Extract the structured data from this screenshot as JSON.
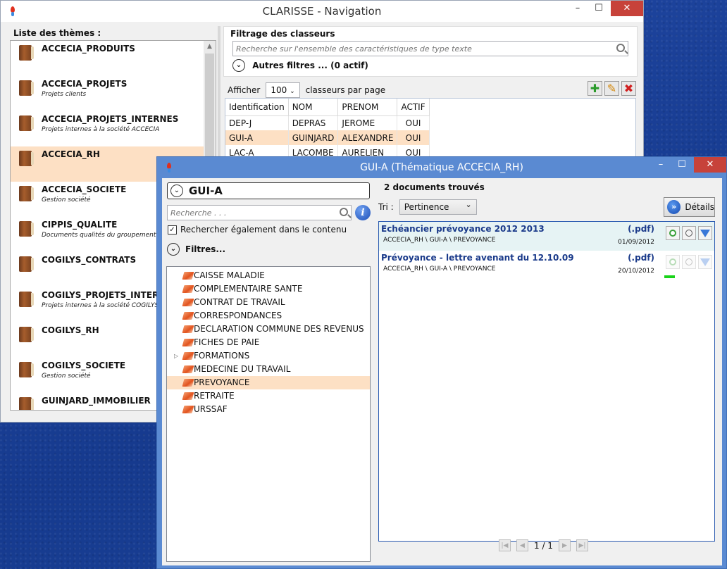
{
  "win1": {
    "title": "CLARISSE - Navigation",
    "controls": {
      "minimize": "–",
      "maximize": "☐",
      "close": "✕"
    },
    "themes_label": "Liste des thèmes :",
    "themes": [
      {
        "name": "ACCECIA_PRODUITS",
        "desc": ""
      },
      {
        "name": "ACCECIA_PROJETS",
        "desc": "Projets clients"
      },
      {
        "name": "ACCECIA_PROJETS_INTERNES",
        "desc": "Projets internes à la société ACCECIA"
      },
      {
        "name": "ACCECIA_RH",
        "desc": ""
      },
      {
        "name": "ACCECIA_SOCIETE",
        "desc": "Gestion société"
      },
      {
        "name": "CIPPIS_QUALITE",
        "desc": "Documents qualités du groupement"
      },
      {
        "name": "COGILYS_CONTRATS",
        "desc": ""
      },
      {
        "name": "COGILYS_PROJETS_INTERNES",
        "desc": "Projets internes à la société COGILYS"
      },
      {
        "name": "COGILYS_RH",
        "desc": ""
      },
      {
        "name": "COGILYS_SOCIETE",
        "desc": "Gestion société"
      },
      {
        "name": "GUINJARD_IMMOBILIER",
        "desc": ""
      }
    ],
    "selected_theme": "ACCECIA_RH",
    "filter": {
      "title": "Filtrage des classeurs",
      "search_placeholder": "Recherche sur l'ensemble des caractéristiques de type texte",
      "more_filters": "Autres filtres ... (0 actif)"
    },
    "paging": {
      "label_before": "Afficher",
      "per_page": "100",
      "label_after": "classeurs par page"
    },
    "table": {
      "columns": [
        "Identification",
        "NOM",
        "PRENOM",
        "ACTIF"
      ],
      "rows": [
        [
          "DEP-J",
          "DEPRAS",
          "JEROME",
          "OUI"
        ],
        [
          "GUI-A",
          "GUINJARD",
          "ALEXANDRE",
          "OUI"
        ],
        [
          "LAC-A",
          "LACOMBE",
          "AURELIEN",
          "OUI"
        ]
      ]
    }
  },
  "win2": {
    "title": "GUI-A (Thématique ACCECIA_RH)",
    "controls": {
      "minimize": "–",
      "maximize": "☐",
      "close": "✕"
    },
    "nav_title": "GUI-A",
    "search_placeholder": "Recherche . . .",
    "info_icon": "i",
    "checkbox_label": "Rechercher également dans le contenu",
    "checkbox_checked": true,
    "filters_label": "Filtres...",
    "tree": [
      {
        "label": "CAISSE MALADIE",
        "expandable": false
      },
      {
        "label": "COMPLEMENTAIRE SANTE",
        "expandable": false
      },
      {
        "label": "CONTRAT DE TRAVAIL",
        "expandable": false
      },
      {
        "label": "CORRESPONDANCES",
        "expandable": false
      },
      {
        "label": "DECLARATION COMMUNE DES REVENUS",
        "expandable": false
      },
      {
        "label": "FICHES DE PAIE",
        "expandable": false
      },
      {
        "label": "FORMATIONS",
        "expandable": true
      },
      {
        "label": "MEDECINE DU TRAVAIL",
        "expandable": false
      },
      {
        "label": "PREVOYANCE",
        "expandable": false
      },
      {
        "label": "RETRAITE",
        "expandable": false
      },
      {
        "label": "URSSAF",
        "expandable": false
      }
    ],
    "selected_tree_item": "PREVOYANCE",
    "result_count": "2 documents trouvés",
    "sort": {
      "label": "Tri :",
      "value": "Pertinence"
    },
    "details_button": "Détails",
    "documents": [
      {
        "title": "Echéancier prévoyance 2012 2013",
        "ext": "(.pdf)",
        "path": "ACCECIA_RH \\ GUI-A \\ PREVOYANCE",
        "date": "01/09/2012"
      },
      {
        "title": "Prévoyance - lettre avenant du 12.10.09",
        "ext": "(.pdf)",
        "path": "ACCECIA_RH \\ GUI-A \\ PREVOYANCE",
        "date": "20/10/2012"
      }
    ],
    "pager": "1 / 1"
  }
}
